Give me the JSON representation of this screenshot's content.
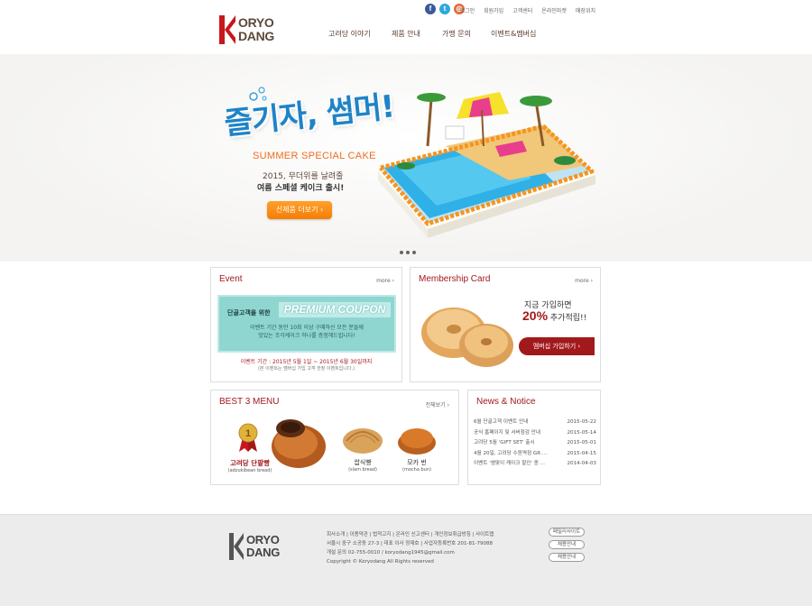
{
  "brand": {
    "line1": "ORYO",
    "line2": "DANG"
  },
  "social": [
    {
      "name": "facebook",
      "glyph": "f"
    },
    {
      "name": "twitter",
      "glyph": "t"
    },
    {
      "name": "instagram",
      "glyph": "◎"
    }
  ],
  "util_nav": [
    "로그인",
    "회원가입",
    "고객센터",
    "온라인마켓",
    "매장위치"
  ],
  "gnb": [
    "고려당 이야기",
    "제품 안내",
    "가맹 문의",
    "이벤트&멤버십"
  ],
  "hero": {
    "headline": "즐기자, 썸머!",
    "subtitle": "SUMMER SPECIAL CAKE",
    "line1": "2015, 무더위를 날려줄",
    "line2": "여름 스페셜 케이크 출시!",
    "button": "신제품 더보기 ›"
  },
  "event": {
    "title": "Event",
    "more": "more ›",
    "coupon_tag": "단골고객을 위한",
    "coupon_main": "PREMIUM COUPON",
    "coupon_desc1": "이벤트 기간 동안 10회 이상 구매하신 모든 분들께",
    "coupon_desc2": "맛있는 조각케이크 하나를 증정해드립니다!",
    "period": "이벤트 기간 : 2015년 5월 1일 ~ 2015년 6월 30일까지",
    "note": "(본 이벤트는 멤버십 가입 고객 한정 이벤트입니다.)"
  },
  "membership": {
    "title": "Membership Card",
    "more": "more ›",
    "line1": "지금 가입하면",
    "highlight": "20%",
    "line2_rest": " 추가적립!!",
    "button": "멤버십 가입하기 ›"
  },
  "best": {
    "title": "BEST 3 MENU",
    "more": "전체보기 ›",
    "rank_badge": "1",
    "items": [
      {
        "name": "고려당 단팥빵",
        "en": "(adzukibean bread)"
      },
      {
        "name": "쌉식빵",
        "en": "(slam bread)"
      },
      {
        "name": "모카 번",
        "en": "(mocha bun)"
      }
    ]
  },
  "news": {
    "title": "News & Notice",
    "items": [
      {
        "text": "6월 단골고객 이벤트 안내",
        "date": "2015-05-22"
      },
      {
        "text": "공식 홈페이지 및 서버점검 안내",
        "date": "2015-05-14"
      },
      {
        "text": "고려당 5월 'GIFT SET' 출시",
        "date": "2015-05-01"
      },
      {
        "text": "4월 20일, 고려당 수원역점 GR ...",
        "date": "2015-04-15"
      },
      {
        "text": "이벤트 '썸맞이 케이크 할인' 종 ...",
        "date": "2014-04-03"
      }
    ]
  },
  "footer": {
    "links": "회사소개  |  이용약관  |  법적고지  |  온라인 신고센터  |  개인정보취급방침  |  사이트맵",
    "address": "서울시 중구 소공동 27-3  |  대표 이사 정재호  |  사업자등록번호 201-81-79088",
    "contact": "개설 문의 02-755-0010 / koryodang1945@gmail.com",
    "copyright": "Copyright © Koryodang All Rights reserved",
    "buttons": [
      "패밀리사이트",
      "채용안내",
      "채용안내"
    ]
  },
  "colors": {
    "accent": "#a2191c",
    "orange": "#f47d06",
    "sky": "#1f83c7",
    "mint": "#8fd6d1"
  }
}
